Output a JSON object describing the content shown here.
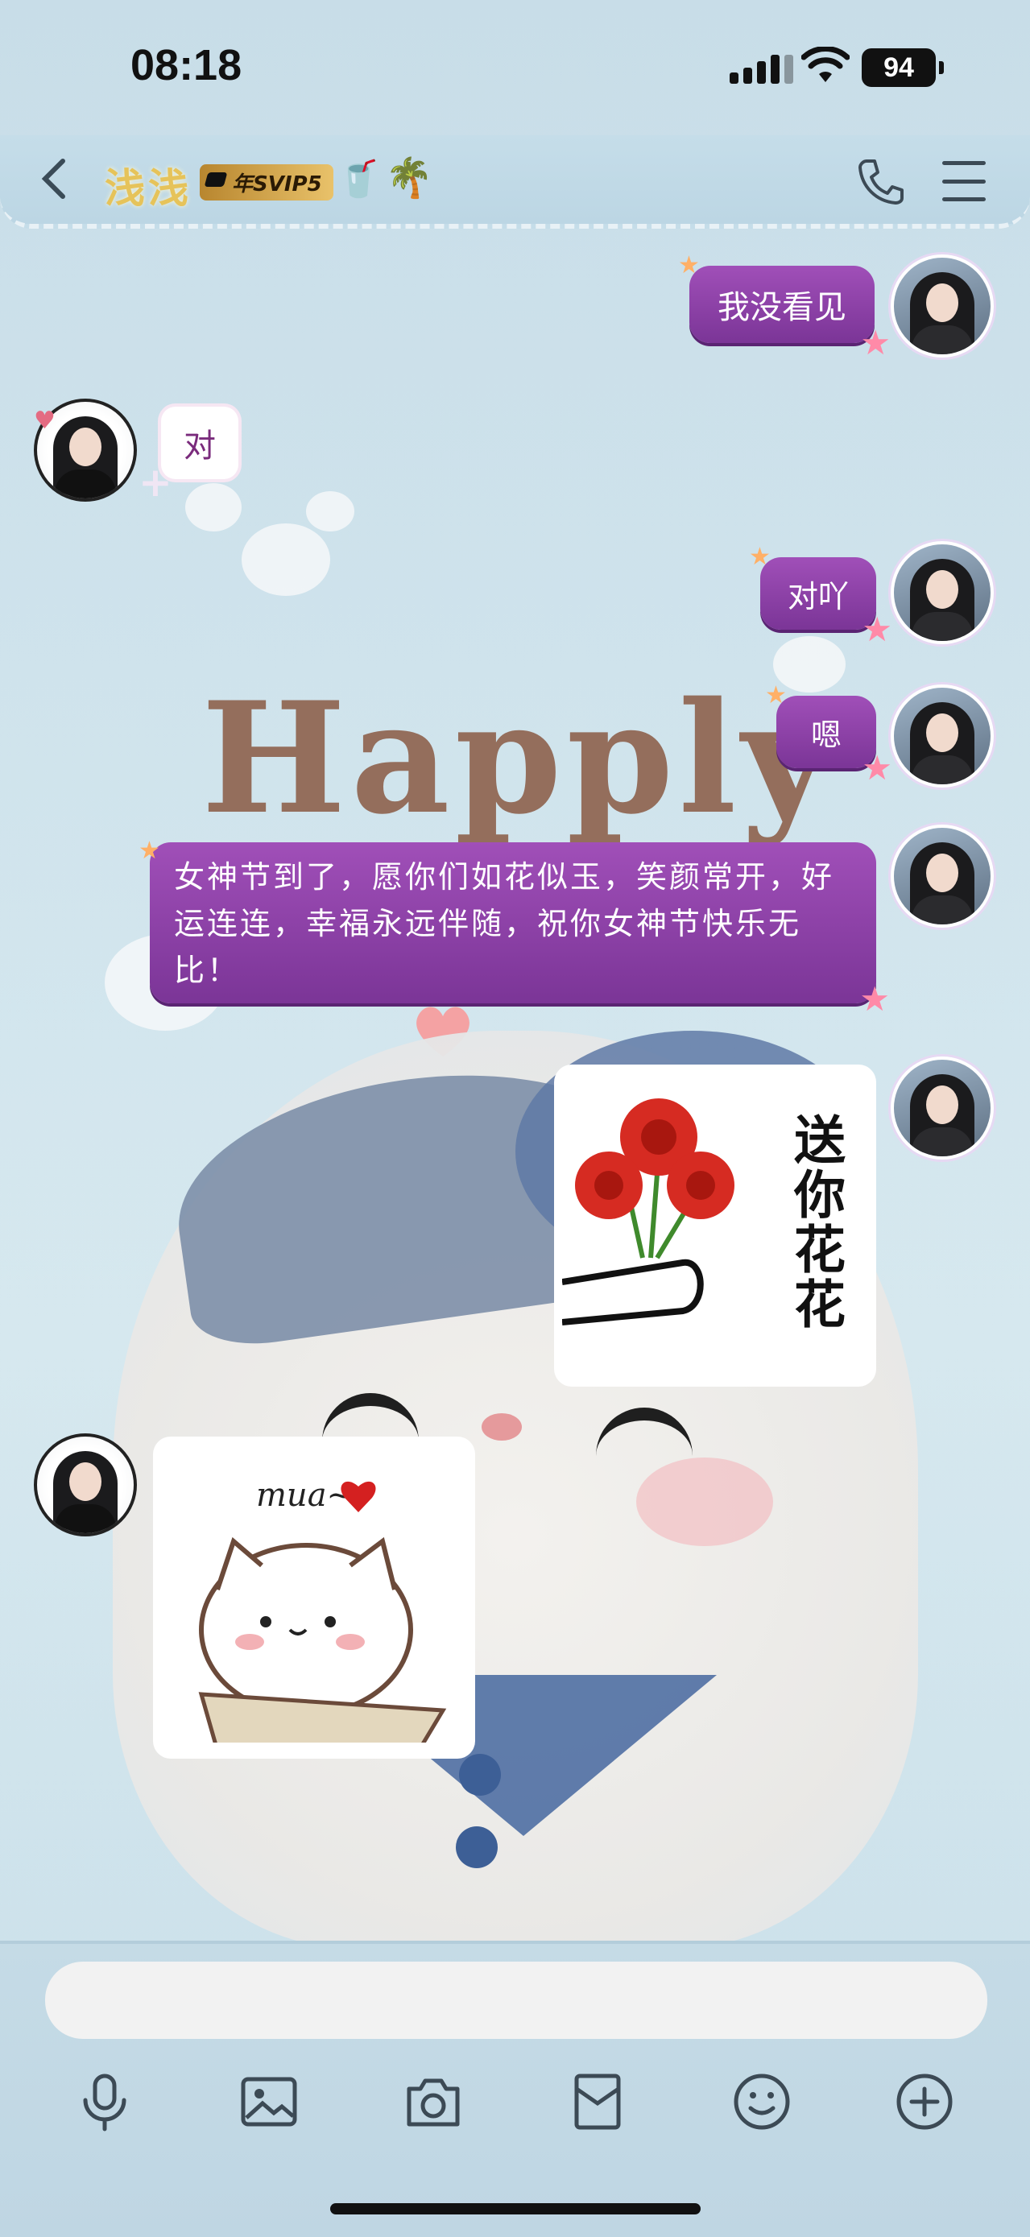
{
  "status_bar": {
    "time": "08:18",
    "battery": "94"
  },
  "header": {
    "contact_name": "浅浅",
    "vip_badge": "年SVIP5",
    "badge_icons": [
      "drink-icon",
      "palm-tree-icon"
    ],
    "actions": [
      "phone-icon",
      "menu-icon"
    ]
  },
  "wallpaper": {
    "text": "Happly"
  },
  "messages": [
    {
      "side": "right",
      "type": "text",
      "text": "我没看见"
    },
    {
      "side": "left",
      "type": "text",
      "text": "对"
    },
    {
      "side": "right",
      "type": "text",
      "text": "对吖"
    },
    {
      "side": "right",
      "type": "text",
      "text": "嗯"
    },
    {
      "side": "right",
      "type": "text",
      "text": "女神节到了，愿你们如花似玉，笑颜常开，好运连连，幸福永远伴随，祝你女神节快乐无比！"
    },
    {
      "side": "right",
      "type": "sticker",
      "text": "送你花花"
    },
    {
      "side": "left",
      "type": "sticker",
      "text": "mua~"
    }
  ],
  "input": {
    "placeholder": "",
    "tools": [
      "microphone-icon",
      "image-icon",
      "camera-icon",
      "red-packet-icon",
      "emoji-icon",
      "plus-icon"
    ]
  },
  "colors": {
    "bubble": "#8e40a8",
    "name": "#e6c35a",
    "background": "#cfe3ec"
  }
}
